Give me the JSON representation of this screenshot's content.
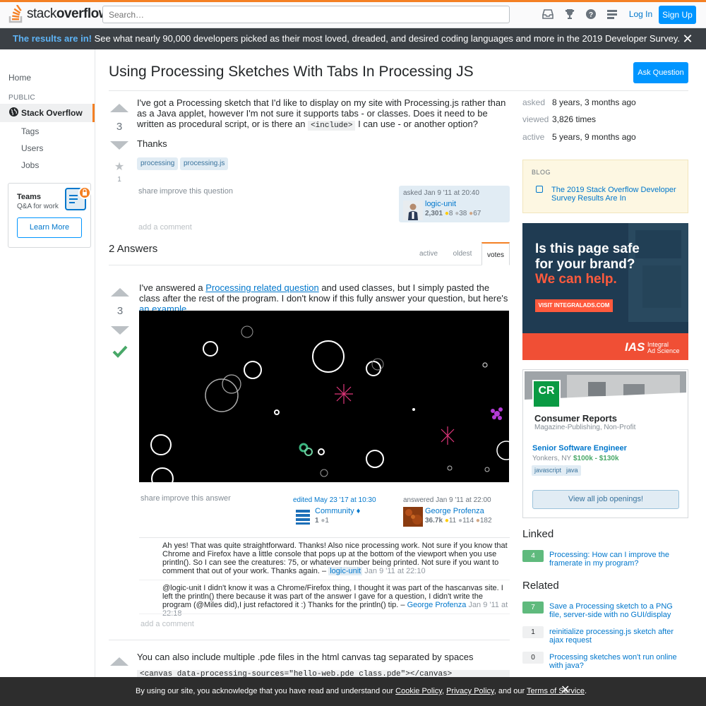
{
  "header": {
    "logo_text_1": "stack",
    "logo_text_2": "overflow",
    "search_placeholder": "Search…",
    "login_label": "Log In",
    "signup_label": "Sign Up"
  },
  "banner": {
    "highlight": "The results are in!",
    "text": " See what nearly 90,000 developers picked as their most loved, dreaded, and desired coding languages and more in the 2019 Developer Survey."
  },
  "sidebar": {
    "home": "Home",
    "public_label": "PUBLIC",
    "stack_overflow": "Stack Overflow",
    "tags": "Tags",
    "users": "Users",
    "jobs": "Jobs",
    "teams_title": "Teams",
    "teams_sub": "Q&A for work",
    "learn_more": "Learn More"
  },
  "question": {
    "title": "Using Processing Sketches With Tabs In Processing JS",
    "ask_button": "Ask Question",
    "votes": "3",
    "fav_count": "1",
    "body_1": "I've got a Processing sketch that I'd like to display on my site with Processing.js rather than as a Java applet, however I'm not sure it supports tabs - or classes. Does it need to be written as procedural script, or is there an ",
    "body_code": "<include>",
    "body_2": " I can use - or another option?",
    "thanks": "Thanks",
    "tags": [
      "processing",
      "processing.js"
    ],
    "share": "share",
    "improve": "improve this question",
    "asked_time": "asked Jan 9 '11 at 20:40",
    "user": "logic-unit",
    "rep": "2,301",
    "gold": "8",
    "silver": "38",
    "bronze": "67",
    "add_comment": "add a comment"
  },
  "stats": {
    "asked_k": "asked",
    "asked_v": "8 years, 3 months ago",
    "viewed_k": "viewed",
    "viewed_v": "3,826 times",
    "active_k": "active",
    "active_v": "5 years, 9 months ago"
  },
  "blog": {
    "heading": "BLOG",
    "link": "The 2019 Stack Overflow Developer Survey Results Are In"
  },
  "ad": {
    "line1": "Is this page safe",
    "line2": "for your brand?",
    "line3": "We can help.",
    "button": "VISIT INTEGRALADS.COM",
    "logo": "IAS",
    "logo_sub1": "Integral",
    "logo_sub2": "Ad Science"
  },
  "jobs": {
    "logo": "CR",
    "company": "Consumer Reports",
    "company_sub": "Magazine-Publishing, Non-Profit",
    "title": "Senior Software Engineer",
    "location": "Yonkers, NY",
    "salary": "$100k - $130k",
    "tags": [
      "javascript",
      "java"
    ],
    "view_all": "View all job openings!"
  },
  "answers_header": {
    "count": "2 Answers",
    "tabs": [
      "active",
      "oldest",
      "votes"
    ]
  },
  "answer1": {
    "votes": "3",
    "text_1": "I've answered a ",
    "link_1": "Processing related question",
    "text_2": " and used classes, but I simply pasted the class after the rest of the program. I don't know if this fully answer your question, but here's ",
    "link_2": "an example",
    "share": "share",
    "improve": "improve this answer",
    "edited_time": "edited May 23 '17 at 10:30",
    "editor": "Community",
    "editor_diamond": "♦",
    "editor_rep": "1",
    "editor_silver": "1",
    "answered_time": "answered Jan 9 '11 at 22:00",
    "author": "George Profenza",
    "author_rep": "36.7k",
    "author_gold": "11",
    "author_silver": "114",
    "author_bronze": "182",
    "comment1_text": "Ah yes! That was quite straightforward. Thanks! Also nice processing work. Not sure if you know that Chrome and Firefox have a little console that pops up at the bottom of the viewport when you use println(). So I can see the creatures: 75, or whatever number being printed. Not sure if you want to comment that out of your work. Thanks again. – ",
    "comment1_user": "logic-unit",
    "comment1_time": "Jan 9 '11 at 22:10",
    "comment2_text": "@logic-unit I didn't know it was a Chrome/Firefox thing, I thought it was part of the hascanvas site. I left the println() there because it was part of the answer I gave for a question, I didn't write the program (@Miles did),I just refactored it :) Thanks for the println() tip. – ",
    "comment2_user": "George Profenza",
    "comment2_time": "Jan 9 '11 at 22:18",
    "add_comment": "add a comment"
  },
  "answer2": {
    "text": "You can also include multiple .pde files in the html canvas tag separated by spaces",
    "code": "<canvas data-processing-sources=\"hello-web.pde class.pde\"></canvas>"
  },
  "linked": {
    "heading": "Linked",
    "items": [
      {
        "count": "4",
        "title": "Processing: How can I improve the framerate in my program?"
      }
    ]
  },
  "related": {
    "heading": "Related",
    "items": [
      {
        "count": "7",
        "title": "Save a Processing sketch to a PNG file, server-side with no GUI/display"
      },
      {
        "count": "1",
        "title": "reinitialize processing.js sketch after ajax request"
      },
      {
        "count": "0",
        "title": "Processing sketches won't run online with java?"
      }
    ]
  },
  "cookie": {
    "text_1": "By using our site, you acknowledge that you have read and understand our ",
    "cookie_policy": "Cookie Policy",
    "sep_1": ", ",
    "privacy_policy": "Privacy Policy",
    "sep_2": ", and our ",
    "terms": "Terms of Service",
    "end": "."
  }
}
